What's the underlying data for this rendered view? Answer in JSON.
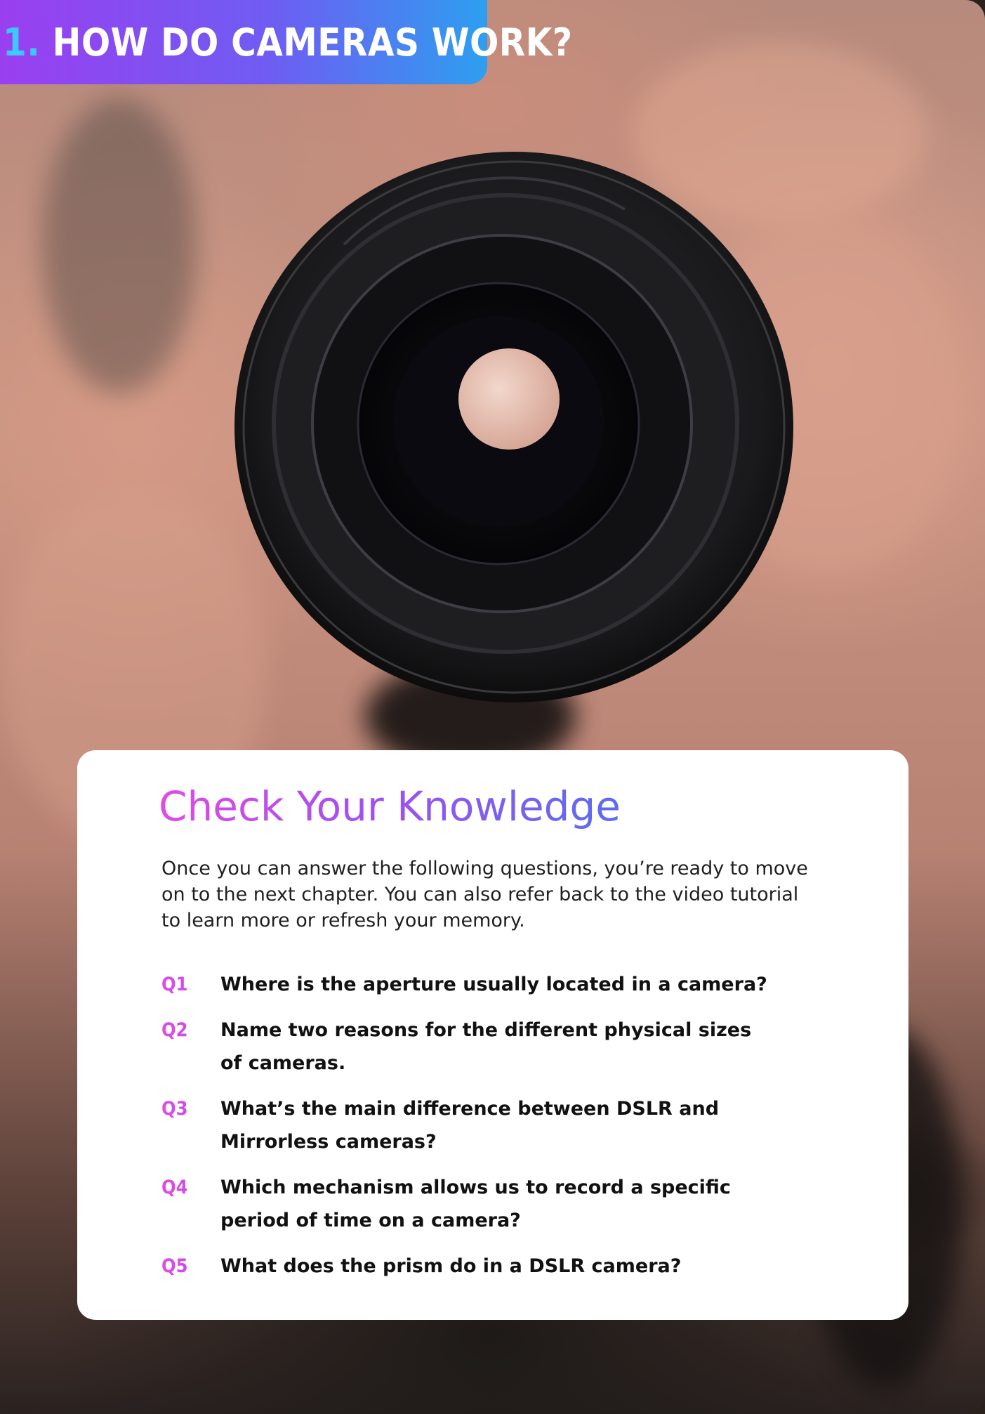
{
  "header": {
    "number": "1.",
    "title": "HOW DO CAMERAS WORK?"
  },
  "background_image": {
    "description_icon": "camera-lens-photo"
  },
  "card": {
    "heading": "Check Your Knowledge",
    "intro": "Once you can answer the following questions, you’re ready to move on to the next chapter. You can also refer back to the video tutorial to learn more or refresh your memory.",
    "questions": [
      {
        "label": "Q1",
        "text": "Where is the aperture usually located in a camera?"
      },
      {
        "label": "Q2",
        "text": "Name two reasons for the different physical sizes of cameras."
      },
      {
        "label": "Q3",
        "text": "What’s the main difference between DSLR and Mirrorless cameras?"
      },
      {
        "label": "Q4",
        "text": "Which mechanism allows us to record a specific period of time on a camera?"
      },
      {
        "label": "Q5",
        "text": "What does the prism do in a DSLR camera?"
      }
    ]
  },
  "colors": {
    "banner_start": "#9a3ff0",
    "banner_end": "#2d9ff0",
    "accent_pink": "#e14be6",
    "accent_blue": "#5a6cf0"
  }
}
